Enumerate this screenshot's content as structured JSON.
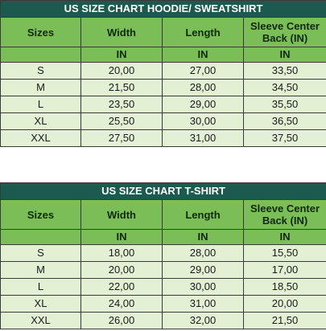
{
  "tables": [
    {
      "title": "US SIZE CHART HOODIE/ SWEATSHIRT",
      "headers": [
        "Sizes",
        "Width",
        "Length",
        "Sleeve Center Back (IN)"
      ],
      "units": [
        "",
        "IN",
        "IN",
        "IN"
      ],
      "rows": [
        [
          "S",
          "20,00",
          "27,00",
          "33,50"
        ],
        [
          "M",
          "21,50",
          "28,00",
          "34,50"
        ],
        [
          "L",
          "23,50",
          "29,00",
          "35,50"
        ],
        [
          "XL",
          "25,50",
          "30,00",
          "36,50"
        ],
        [
          "XXL",
          "27,50",
          "31,00",
          "37,50"
        ]
      ]
    },
    {
      "title": "US SIZE CHART T-SHIRT",
      "headers": [
        "Sizes",
        "Width",
        "Length",
        "Sleeve Center Back (IN)"
      ],
      "units": [
        "",
        "IN",
        "IN",
        "IN"
      ],
      "rows": [
        [
          "S",
          "18,00",
          "28,00",
          "15,50"
        ],
        [
          "M",
          "20,00",
          "29,00",
          "17,00"
        ],
        [
          "L",
          "22,00",
          "30,00",
          "18,50"
        ],
        [
          "XL",
          "24,00",
          "31,00",
          "20,00"
        ],
        [
          "XXL",
          "26,00",
          "32,00",
          "21,50"
        ]
      ]
    }
  ],
  "colors": {
    "title_bg": "#1c5a50",
    "header_bg": "#7bbd57",
    "row_bg": "#e3f0d3"
  }
}
